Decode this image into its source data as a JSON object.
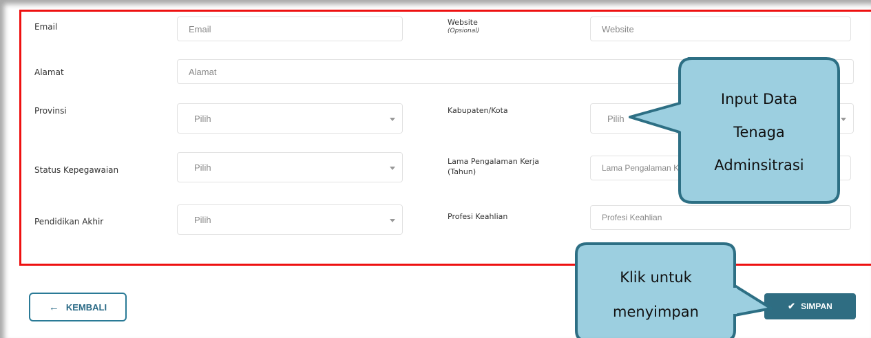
{
  "form": {
    "email": {
      "label": "Email",
      "placeholder": "Email"
    },
    "website": {
      "label": "Website",
      "note": "(Opsional)",
      "placeholder": "Website"
    },
    "alamat": {
      "label": "Alamat",
      "placeholder": "Alamat"
    },
    "provinsi": {
      "label": "Provinsi",
      "value": "Pilih"
    },
    "kabupaten": {
      "label": "Kabupaten/Kota",
      "value": "Pilih"
    },
    "status": {
      "label": "Status Kepegawaian",
      "value": "Pilih"
    },
    "lama": {
      "label_line1": "Lama Pengalaman Kerja",
      "label_line2": "(Tahun)",
      "placeholder": "Lama Pengalaman Kerja"
    },
    "pendidikan": {
      "label": "Pendidikan Akhir",
      "value": "Pilih"
    },
    "profesi": {
      "label": "Profesi Keahlian",
      "placeholder": "Profesi Keahlian"
    }
  },
  "actions": {
    "back_label": "KEMBALI",
    "save_label": "SIMPAN"
  },
  "callouts": {
    "input_line1": "Input Data",
    "input_line2": "Tenaga",
    "input_line3": "Adminsitrasi",
    "save_line1": "Klik untuk",
    "save_line2": "menyimpan"
  },
  "colors": {
    "highlight_border": "#ee1111",
    "callout_fill": "#9ccfe0",
    "callout_border": "#2d6f84",
    "primary": "#2f6d82"
  }
}
